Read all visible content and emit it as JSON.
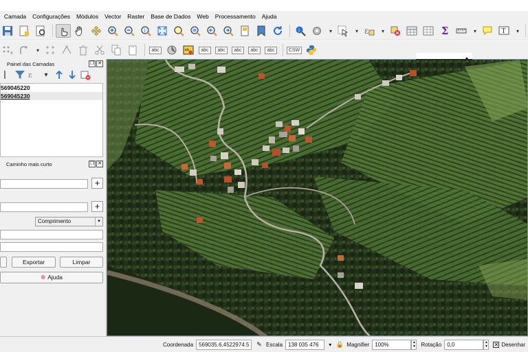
{
  "menubar": [
    "Camada",
    "Configurações",
    "Módulos",
    "Vector",
    "Raster",
    "Base de Dados",
    "Web",
    "Processamento",
    "Ajuda"
  ],
  "toolbar": {
    "csw_label": "CSW",
    "abc_label": "abc",
    "sigma_label": "Σ"
  },
  "layers_panel": {
    "title": "Painel das Camadas",
    "layers": [
      "569045220",
      "569045230"
    ]
  },
  "shortest_path_panel": {
    "title": "Caminho mais curto",
    "criterion_value": "Comprimento",
    "export_label": "Exportar",
    "clear_label": "Limpar",
    "help_label": "Ajuda"
  },
  "statusbar": {
    "coordinate_label": "Coordenada",
    "coordinate_value": "569035.6,4522974.5",
    "scale_label": "Escala",
    "scale_value": "138 035 476",
    "magnifier_label": "Magnifier",
    "magnifier_value": "100%",
    "rotation_label": "Rotação",
    "rotation_value": "0,0",
    "render_label": "Desenhar",
    "render_checked": true
  },
  "colors": {
    "chrome": "#f0f0f0",
    "map_border": "#6f8fb7",
    "forest_dark": "#24321d",
    "terrace_green": "#4f7a34"
  }
}
